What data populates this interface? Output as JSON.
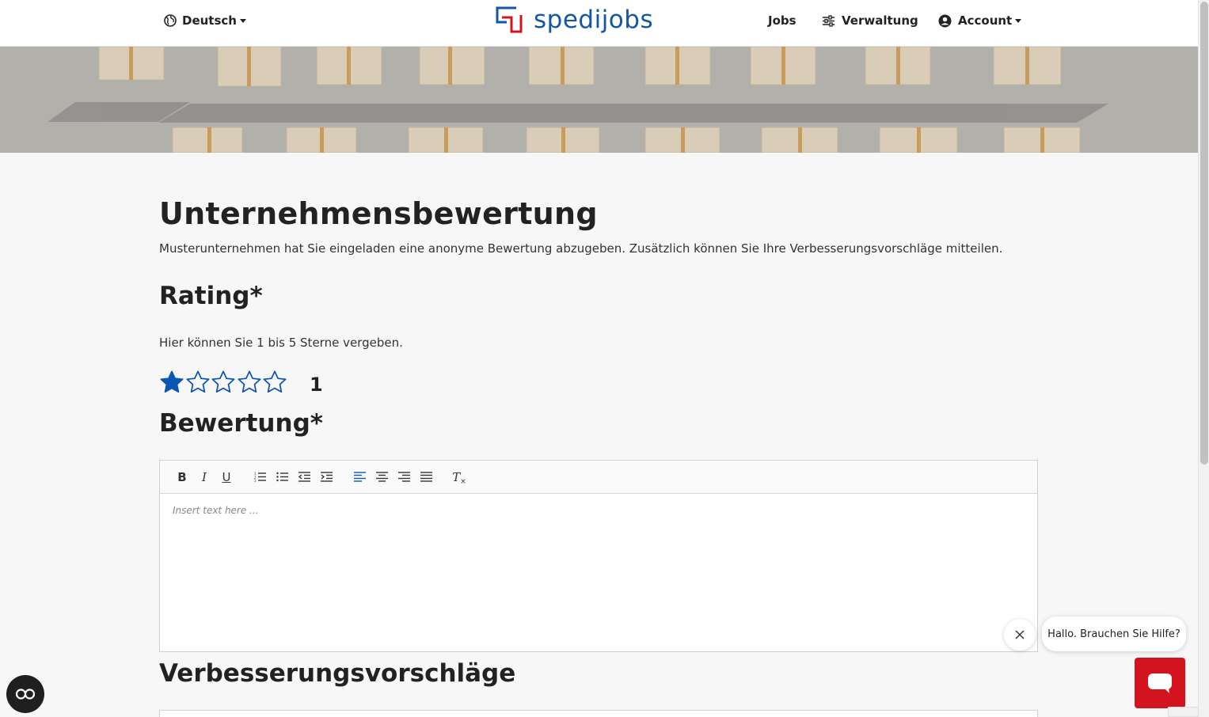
{
  "header": {
    "language_label": "Deutsch",
    "logo_text": "spedijobs",
    "nav_jobs": "Jobs",
    "nav_verwaltung": "Verwaltung",
    "nav_account": "Account"
  },
  "page": {
    "title": "Unternehmensbewertung",
    "intro": "Musterunternehmen hat Sie eingeladen eine anonyme Bewertung abzugeben. Zusätzlich können Sie Ihre Verbesserungsvorschläge mitteilen."
  },
  "rating": {
    "title": "Rating*",
    "hint": "Hier können Sie 1 bis 5 Sterne vergeben.",
    "value": "1",
    "max_stars": 5,
    "filled_stars": 1,
    "star_color": "#0a56b3"
  },
  "review": {
    "title": "Bewertung*",
    "placeholder": "Insert text here ...",
    "toolbar": {
      "bold": "B",
      "italic": "I",
      "underline": "U",
      "clear_format": "T"
    }
  },
  "suggestions": {
    "title": "Verbesserungsvorschläge"
  },
  "chat": {
    "message": "Hallo. Brauchen Sie Hilfe?",
    "launcher_color": "#d3141f"
  },
  "icons": {
    "language": "globe-icon",
    "verwaltung": "sliders-icon",
    "account": "user-circle-icon",
    "accessibility": "accessibility-icon"
  },
  "colors": {
    "brand_blue": "#1257a6",
    "brand_red": "#d3141f"
  }
}
